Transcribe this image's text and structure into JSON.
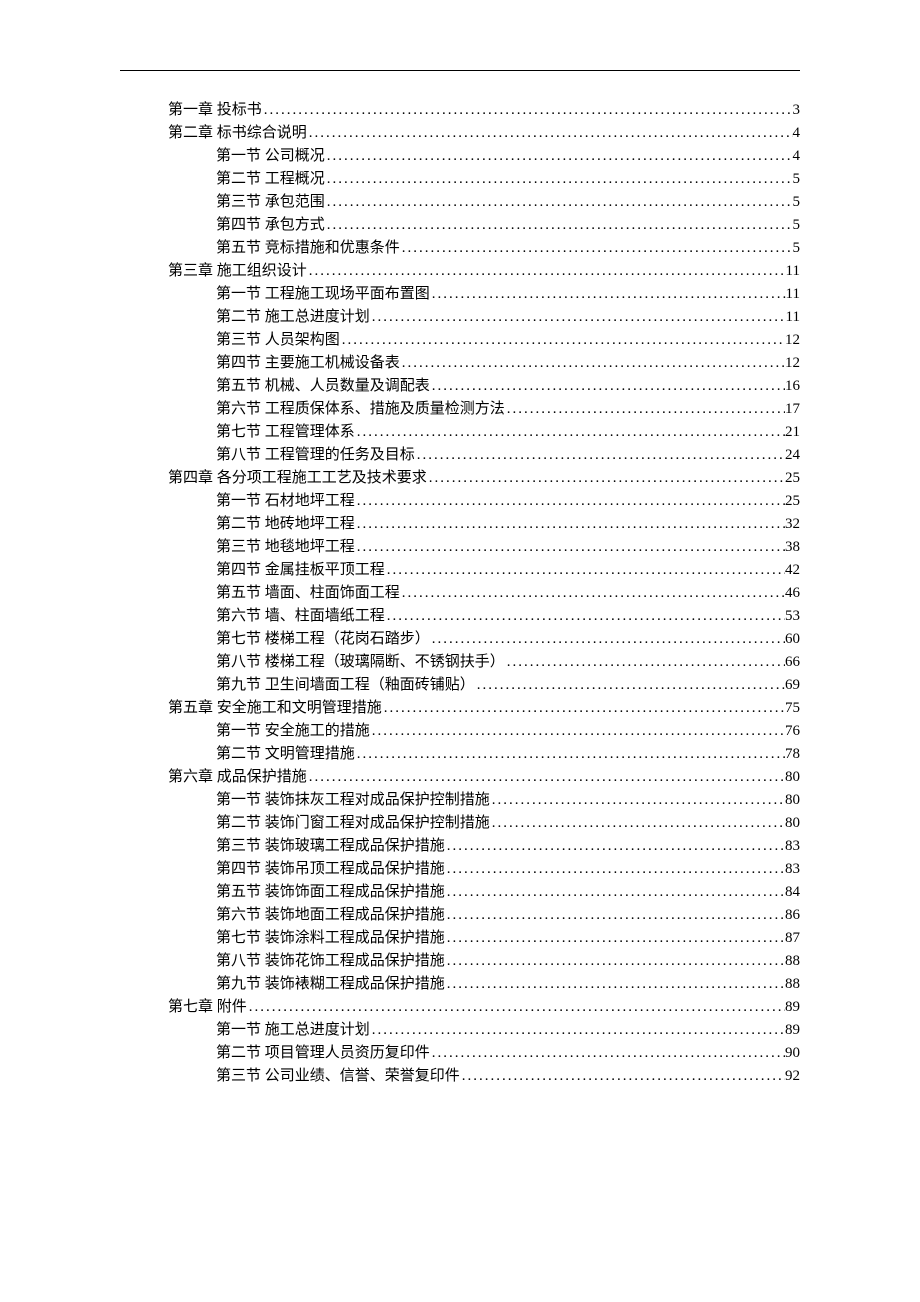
{
  "toc": [
    {
      "level": 0,
      "label": "第一章 投标书",
      "page": "3"
    },
    {
      "level": 0,
      "label": "第二章 标书综合说明",
      "page": "4"
    },
    {
      "level": 1,
      "label": "第一节 公司概况",
      "page": "4"
    },
    {
      "level": 1,
      "label": "第二节 工程概况",
      "page": "5"
    },
    {
      "level": 1,
      "label": "第三节 承包范围",
      "page": "5"
    },
    {
      "level": 1,
      "label": "第四节 承包方式",
      "page": "5"
    },
    {
      "level": 1,
      "label": "第五节 竞标措施和优惠条件",
      "page": "5"
    },
    {
      "level": 0,
      "label": "第三章 施工组织设计",
      "page": "11"
    },
    {
      "level": 1,
      "label": "第一节 工程施工现场平面布置图",
      "page": "11"
    },
    {
      "level": 1,
      "label": "第二节 施工总进度计划",
      "page": "11"
    },
    {
      "level": 1,
      "label": "第三节 人员架构图",
      "page": "12"
    },
    {
      "level": 1,
      "label": "第四节 主要施工机械设备表",
      "page": "12"
    },
    {
      "level": 1,
      "label": "第五节 机械、人员数量及调配表",
      "page": "16"
    },
    {
      "level": 1,
      "label": "第六节 工程质保体系、措施及质量检测方法",
      "page": "17"
    },
    {
      "level": 1,
      "label": "第七节 工程管理体系",
      "page": "21"
    },
    {
      "level": 1,
      "label": "第八节 工程管理的任务及目标",
      "page": "24"
    },
    {
      "level": 0,
      "label": "第四章 各分项工程施工工艺及技术要求",
      "page": "25"
    },
    {
      "level": 1,
      "label": "第一节 石材地坪工程",
      "page": "25"
    },
    {
      "level": 1,
      "label": "第二节 地砖地坪工程",
      "page": "32"
    },
    {
      "level": 1,
      "label": "第三节 地毯地坪工程",
      "page": "38"
    },
    {
      "level": 1,
      "label": "第四节 金属挂板平顶工程",
      "page": "42"
    },
    {
      "level": 1,
      "label": "第五节 墙面、柱面饰面工程",
      "page": "46"
    },
    {
      "level": 1,
      "label": "第六节 墙、柱面墙纸工程",
      "page": "53"
    },
    {
      "level": 1,
      "label": "第七节 楼梯工程（花岗石踏步）",
      "page": "60"
    },
    {
      "level": 1,
      "label": "第八节 楼梯工程（玻璃隔断、不锈钢扶手）",
      "page": "66"
    },
    {
      "level": 1,
      "label": "第九节 卫生间墙面工程（釉面砖铺贴）",
      "page": "69"
    },
    {
      "level": 0,
      "label": "第五章 安全施工和文明管理措施",
      "page": "75"
    },
    {
      "level": 1,
      "label": "第一节 安全施工的措施",
      "page": "76"
    },
    {
      "level": 1,
      "label": "第二节 文明管理措施",
      "page": "78"
    },
    {
      "level": 0,
      "label": "第六章 成品保护措施",
      "page": "80"
    },
    {
      "level": 1,
      "label": "第一节 装饰抹灰工程对成品保护控制措施",
      "page": "80"
    },
    {
      "level": 1,
      "label": "第二节 装饰门窗工程对成品保护控制措施",
      "page": "80"
    },
    {
      "level": 1,
      "label": "第三节 装饰玻璃工程成品保护措施",
      "page": "83"
    },
    {
      "level": 1,
      "label": "第四节 装饰吊顶工程成品保护措施",
      "page": "83"
    },
    {
      "level": 1,
      "label": "第五节 装饰饰面工程成品保护措施",
      "page": "84"
    },
    {
      "level": 1,
      "label": "第六节 装饰地面工程成品保护措施",
      "page": "86"
    },
    {
      "level": 1,
      "label": "第七节 装饰涂料工程成品保护措施",
      "page": "87"
    },
    {
      "level": 1,
      "label": "第八节 装饰花饰工程成品保护措施",
      "page": "88"
    },
    {
      "level": 1,
      "label": "第九节 装饰裱糊工程成品保护措施",
      "page": "88"
    },
    {
      "level": 0,
      "label": "第七章 附件",
      "page": "89"
    },
    {
      "level": 1,
      "label": "第一节 施工总进度计划",
      "page": "89"
    },
    {
      "level": 1,
      "label": "第二节 项目管理人员资历复印件",
      "page": "90"
    },
    {
      "level": 1,
      "label": "第三节 公司业绩、信誉、荣誉复印件",
      "page": "92"
    }
  ]
}
